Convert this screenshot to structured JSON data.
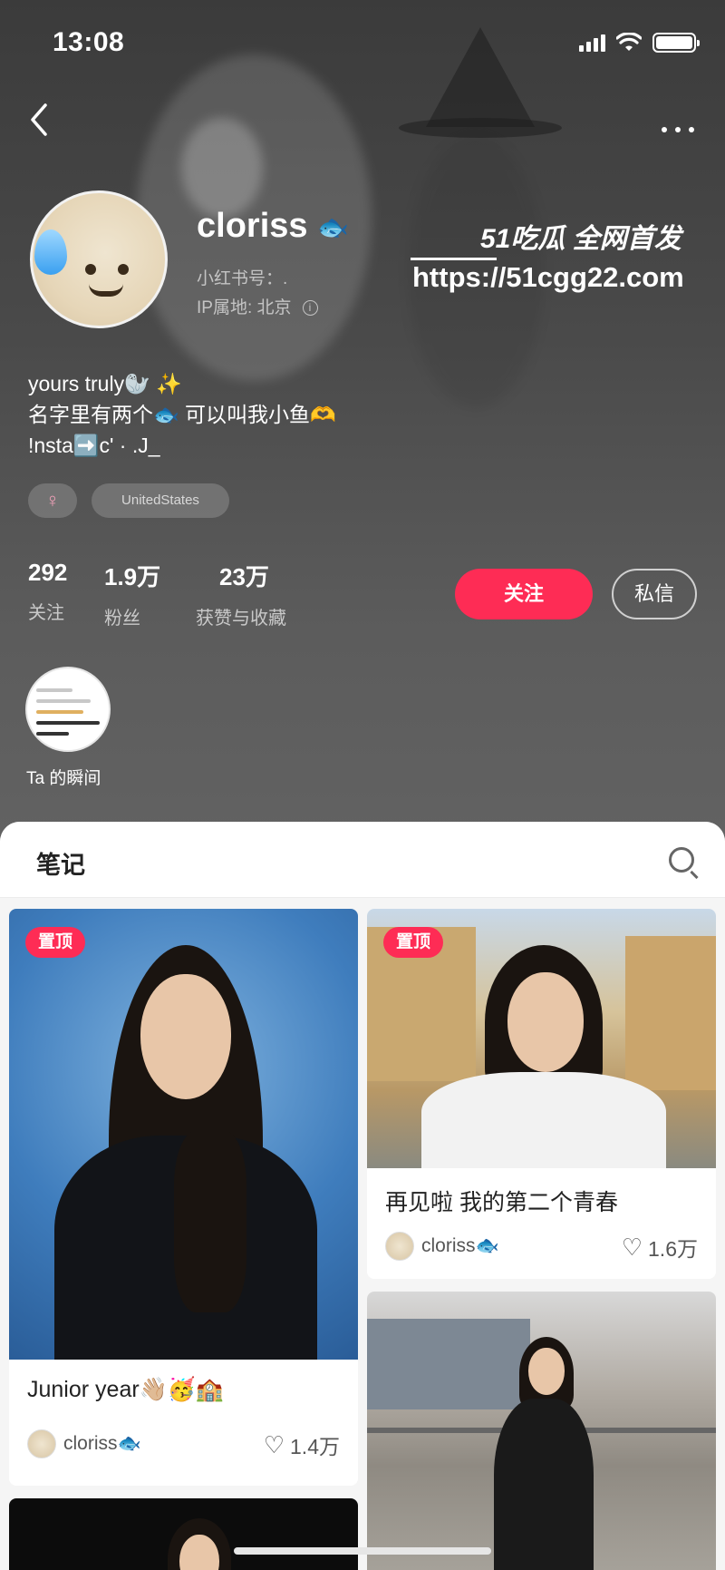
{
  "status_bar": {
    "time": "13:08"
  },
  "profile": {
    "username": "cloriss",
    "username_emoji": "🐟",
    "xhs_id_label": "小红书号：.",
    "ip_label": "IP属地: 北京",
    "bio": [
      "yours truly🦭 ✨",
      "名字里有两个🐟 可以叫我小鱼🫶",
      "!nsta➡️c'  ·  .J_"
    ],
    "gender": "♀",
    "region": "UnitedStates",
    "stats": [
      {
        "num": "292",
        "label": "关注"
      },
      {
        "num": "1.9万",
        "label": "粉丝"
      },
      {
        "num": "23万",
        "label": "获赞与收藏"
      }
    ],
    "follow_label": "关注",
    "message_label": "私信",
    "moment_label": "Ta 的瞬间"
  },
  "watermark": {
    "top": "51吃瓜 全网首发",
    "url": "https://51cgg22.com"
  },
  "notes": {
    "tab_title": "笔记",
    "pin_label": "置顶",
    "cards": [
      {
        "title": "Junior year👋🏼🥳🏫",
        "author": "cloriss🐟",
        "likes": "1.4万"
      },
      {
        "title": "再见啦 我的第二个青春",
        "author": "cloriss🐟",
        "likes": "1.6万"
      }
    ]
  },
  "colors": {
    "accent": "#fe2c55"
  }
}
